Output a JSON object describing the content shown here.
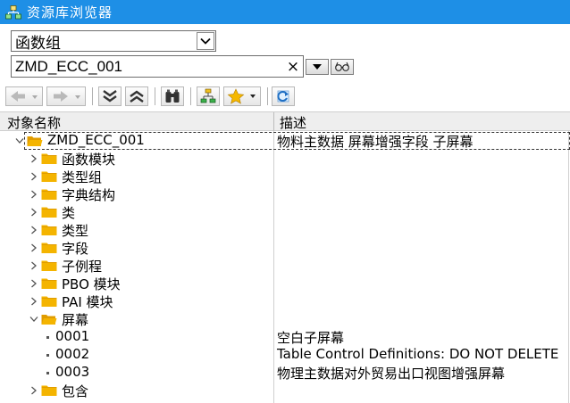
{
  "window": {
    "title": "资源库浏览器"
  },
  "object_type": {
    "selected": "函数组"
  },
  "object_name": {
    "value": "ZMD_ECC_001",
    "clear_symbol": "×"
  },
  "grid": {
    "headers": {
      "name": "对象名称",
      "description": "描述"
    },
    "rows": [
      {
        "level": 0,
        "kind": "folder-open",
        "label": "ZMD_ECC_001",
        "desc": "物料主数据 屏幕增强字段 子屏幕"
      },
      {
        "level": 1,
        "kind": "folder",
        "label": "函数模块",
        "desc": ""
      },
      {
        "level": 1,
        "kind": "folder",
        "label": "类型组",
        "desc": ""
      },
      {
        "level": 1,
        "kind": "folder",
        "label": "字典结构",
        "desc": ""
      },
      {
        "level": 1,
        "kind": "folder",
        "label": "类",
        "desc": ""
      },
      {
        "level": 1,
        "kind": "folder",
        "label": "类型",
        "desc": ""
      },
      {
        "level": 1,
        "kind": "folder",
        "label": "字段",
        "desc": ""
      },
      {
        "level": 1,
        "kind": "folder",
        "label": "子例程",
        "desc": ""
      },
      {
        "level": 1,
        "kind": "folder",
        "label": "PBO 模块",
        "desc": ""
      },
      {
        "level": 1,
        "kind": "folder",
        "label": "PAI 模块",
        "desc": ""
      },
      {
        "level": 1,
        "kind": "folder-open",
        "label": "屏幕",
        "desc": ""
      },
      {
        "level": 2,
        "kind": "leaf",
        "label": "0001",
        "desc": "空白子屏幕"
      },
      {
        "level": 2,
        "kind": "leaf",
        "label": "0002",
        "desc": "Table Control Definitions: DO NOT DELETE"
      },
      {
        "level": 2,
        "kind": "leaf",
        "label": "0003",
        "desc": "物理主数据对外贸易出口视图增强屏幕"
      },
      {
        "level": 1,
        "kind": "folder",
        "label": "包含",
        "desc": ""
      }
    ]
  },
  "colors": {
    "titlebar": "#1e8fe6",
    "folder": "#f4b400",
    "folder_dark": "#e09c00"
  },
  "icons": [
    "hierarchy-icon",
    "chevron-down-icon",
    "clear-icon",
    "glasses-icon",
    "back-arrow-icon",
    "forward-arrow-icon",
    "expand-all-icon",
    "collapse-all-icon",
    "binoculars-icon",
    "sort-tree-icon",
    "favorite-star-icon",
    "refresh-icon"
  ]
}
